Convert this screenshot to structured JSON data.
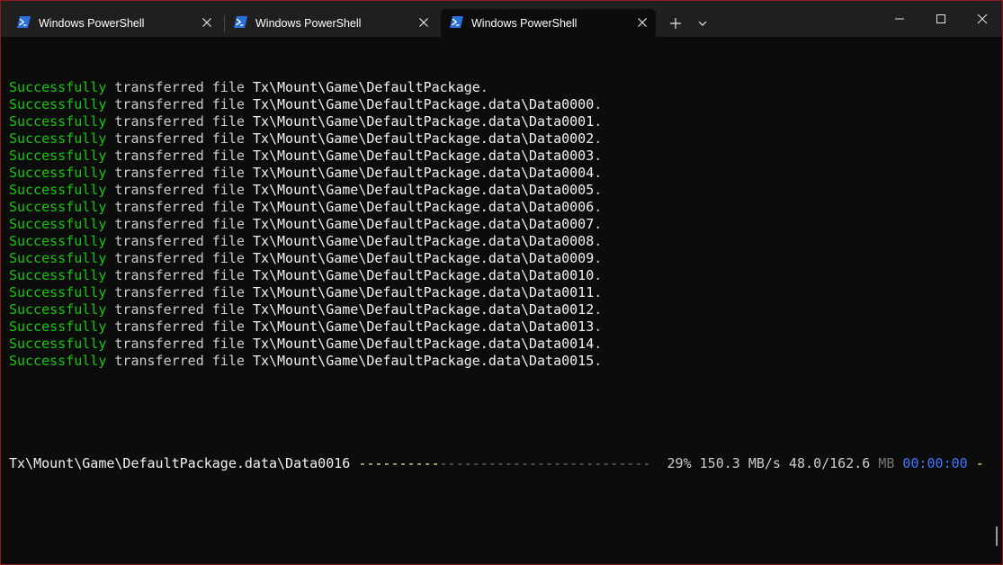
{
  "window": {
    "border_color": "#8a1c1c",
    "background": "#0c0c0c"
  },
  "tabs": [
    {
      "label": "Windows PowerShell",
      "icon": "powershell-icon",
      "active": false
    },
    {
      "label": "Windows PowerShell",
      "icon": "powershell-icon",
      "active": false
    },
    {
      "label": "Windows PowerShell",
      "icon": "powershell-icon",
      "active": true
    }
  ],
  "titlebar_buttons": {
    "new_tab": "plus-icon",
    "dropdown": "chevron-down-icon",
    "minimize": "minimize-icon",
    "maximize": "maximize-icon",
    "close": "close-icon"
  },
  "transfer_lines": [
    {
      "status": "Successfully",
      "action": "transferred file",
      "path": "Tx\\Mount\\Game\\DefaultPackage",
      "end": "."
    },
    {
      "status": "Successfully",
      "action": "transferred file",
      "path": "Tx\\Mount\\Game\\DefaultPackage.data\\Data0000",
      "end": "."
    },
    {
      "status": "Successfully",
      "action": "transferred file",
      "path": "Tx\\Mount\\Game\\DefaultPackage.data\\Data0001",
      "end": "."
    },
    {
      "status": "Successfully",
      "action": "transferred file",
      "path": "Tx\\Mount\\Game\\DefaultPackage.data\\Data0002",
      "end": "."
    },
    {
      "status": "Successfully",
      "action": "transferred file",
      "path": "Tx\\Mount\\Game\\DefaultPackage.data\\Data0003",
      "end": "."
    },
    {
      "status": "Successfully",
      "action": "transferred file",
      "path": "Tx\\Mount\\Game\\DefaultPackage.data\\Data0004",
      "end": "."
    },
    {
      "status": "Successfully",
      "action": "transferred file",
      "path": "Tx\\Mount\\Game\\DefaultPackage.data\\Data0005",
      "end": "."
    },
    {
      "status": "Successfully",
      "action": "transferred file",
      "path": "Tx\\Mount\\Game\\DefaultPackage.data\\Data0006",
      "end": "."
    },
    {
      "status": "Successfully",
      "action": "transferred file",
      "path": "Tx\\Mount\\Game\\DefaultPackage.data\\Data0007",
      "end": "."
    },
    {
      "status": "Successfully",
      "action": "transferred file",
      "path": "Tx\\Mount\\Game\\DefaultPackage.data\\Data0008",
      "end": "."
    },
    {
      "status": "Successfully",
      "action": "transferred file",
      "path": "Tx\\Mount\\Game\\DefaultPackage.data\\Data0009",
      "end": "."
    },
    {
      "status": "Successfully",
      "action": "transferred file",
      "path": "Tx\\Mount\\Game\\DefaultPackage.data\\Data0010",
      "end": "."
    },
    {
      "status": "Successfully",
      "action": "transferred file",
      "path": "Tx\\Mount\\Game\\DefaultPackage.data\\Data0011",
      "end": "."
    },
    {
      "status": "Successfully",
      "action": "transferred file",
      "path": "Tx\\Mount\\Game\\DefaultPackage.data\\Data0012",
      "end": "."
    },
    {
      "status": "Successfully",
      "action": "transferred file",
      "path": "Tx\\Mount\\Game\\DefaultPackage.data\\Data0013",
      "end": "."
    },
    {
      "status": "Successfully",
      "action": "transferred file",
      "path": "Tx\\Mount\\Game\\DefaultPackage.data\\Data0014",
      "end": "."
    },
    {
      "status": "Successfully",
      "action": "transferred file",
      "path": "Tx\\Mount\\Game\\DefaultPackage.data\\Data0015",
      "end": "."
    }
  ],
  "progress": {
    "file": "Tx\\Mount\\Game\\DefaultPackage.data\\Data0016",
    "bar_done": "----------",
    "bar_remaining": "--------------------------",
    "percent": "29%",
    "speed": "150.3 MB/s",
    "size": "48.0/162.6",
    "size_unit": "MB",
    "eta": "00:00:00",
    "spinner": "-"
  },
  "colors": {
    "success": "#16c60c",
    "text": "#cccccc",
    "path": "#f2f2f2",
    "bar_done": "#f9f1a5",
    "bar_remaining": "#767676",
    "eta": "#3b78ff"
  }
}
